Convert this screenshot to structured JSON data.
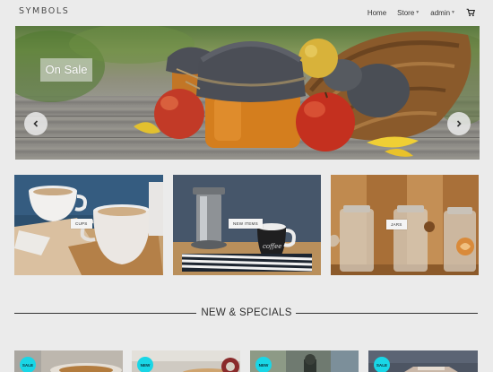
{
  "header": {
    "brand": "SYMBOLS",
    "nav": {
      "home": "Home",
      "store": "Store",
      "admin": "admin"
    }
  },
  "hero": {
    "badge": "On Sale"
  },
  "categories": [
    {
      "label": "CUPS"
    },
    {
      "label": "NEW ITEMS"
    },
    {
      "label": "JARS"
    }
  ],
  "section": {
    "title": "NEW & SPECIALS"
  },
  "products": [
    {
      "badge": "SALE"
    },
    {
      "badge": "NEW"
    },
    {
      "badge": "NEW"
    },
    {
      "badge": "SALE"
    }
  ],
  "colors": {
    "badge_accent": "#19d6e6",
    "page_bg": "#ebebeb"
  },
  "icons": {
    "cart": "cart-icon",
    "prev": "chevron-left-icon",
    "next": "chevron-right-icon"
  }
}
